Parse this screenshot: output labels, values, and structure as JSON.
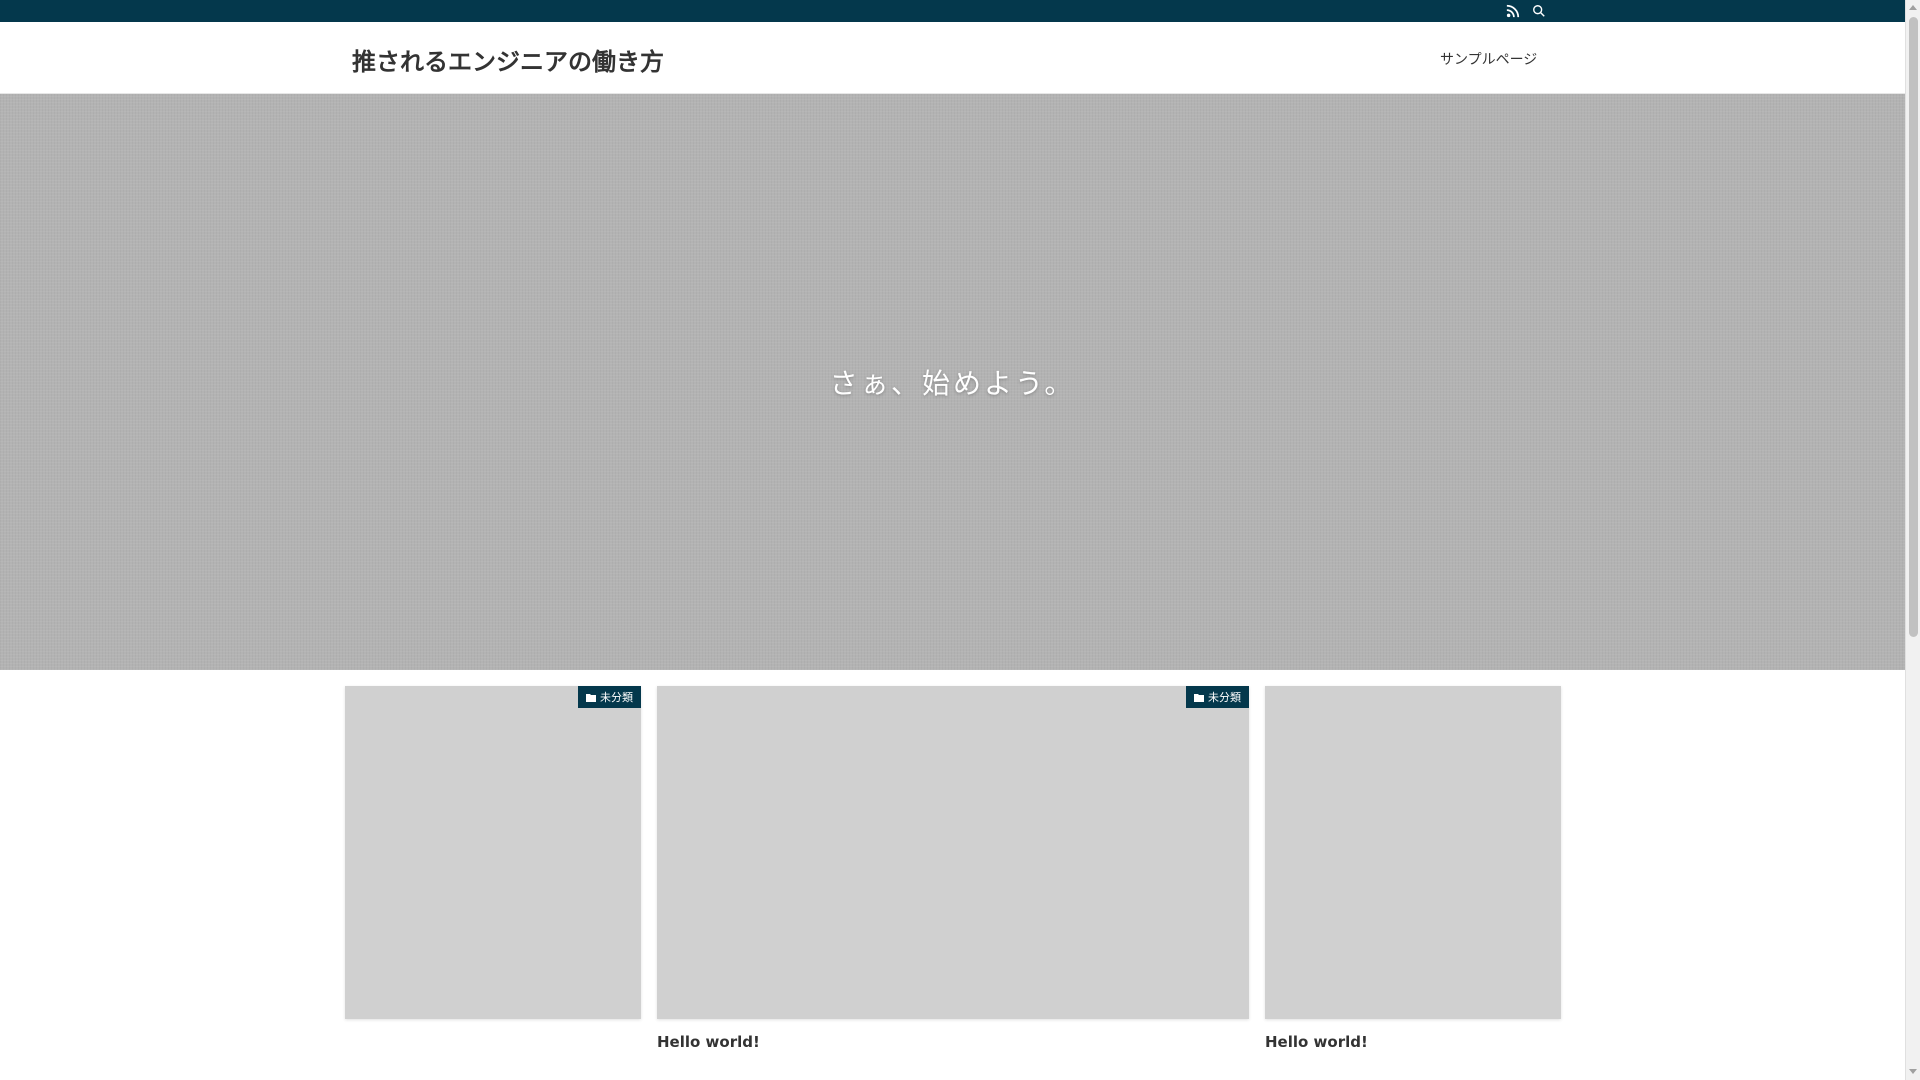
{
  "topbar": {
    "rss_icon": "rss-icon",
    "search_icon": "search-icon"
  },
  "header": {
    "site_title": "推されるエンジニアの働き方",
    "nav_items": [
      "サンプルページ"
    ]
  },
  "hero": {
    "text": "さぁ、始めよう。"
  },
  "cards": [
    {
      "category": "未分類",
      "title": ""
    },
    {
      "category": "未分類",
      "title": "Hello world!"
    },
    {
      "category": "",
      "title": "Hello world!"
    }
  ],
  "colors": {
    "brand": "#04384c",
    "hero_bg": "#b3b3b3",
    "thumb_bg": "#d0d0d0"
  }
}
